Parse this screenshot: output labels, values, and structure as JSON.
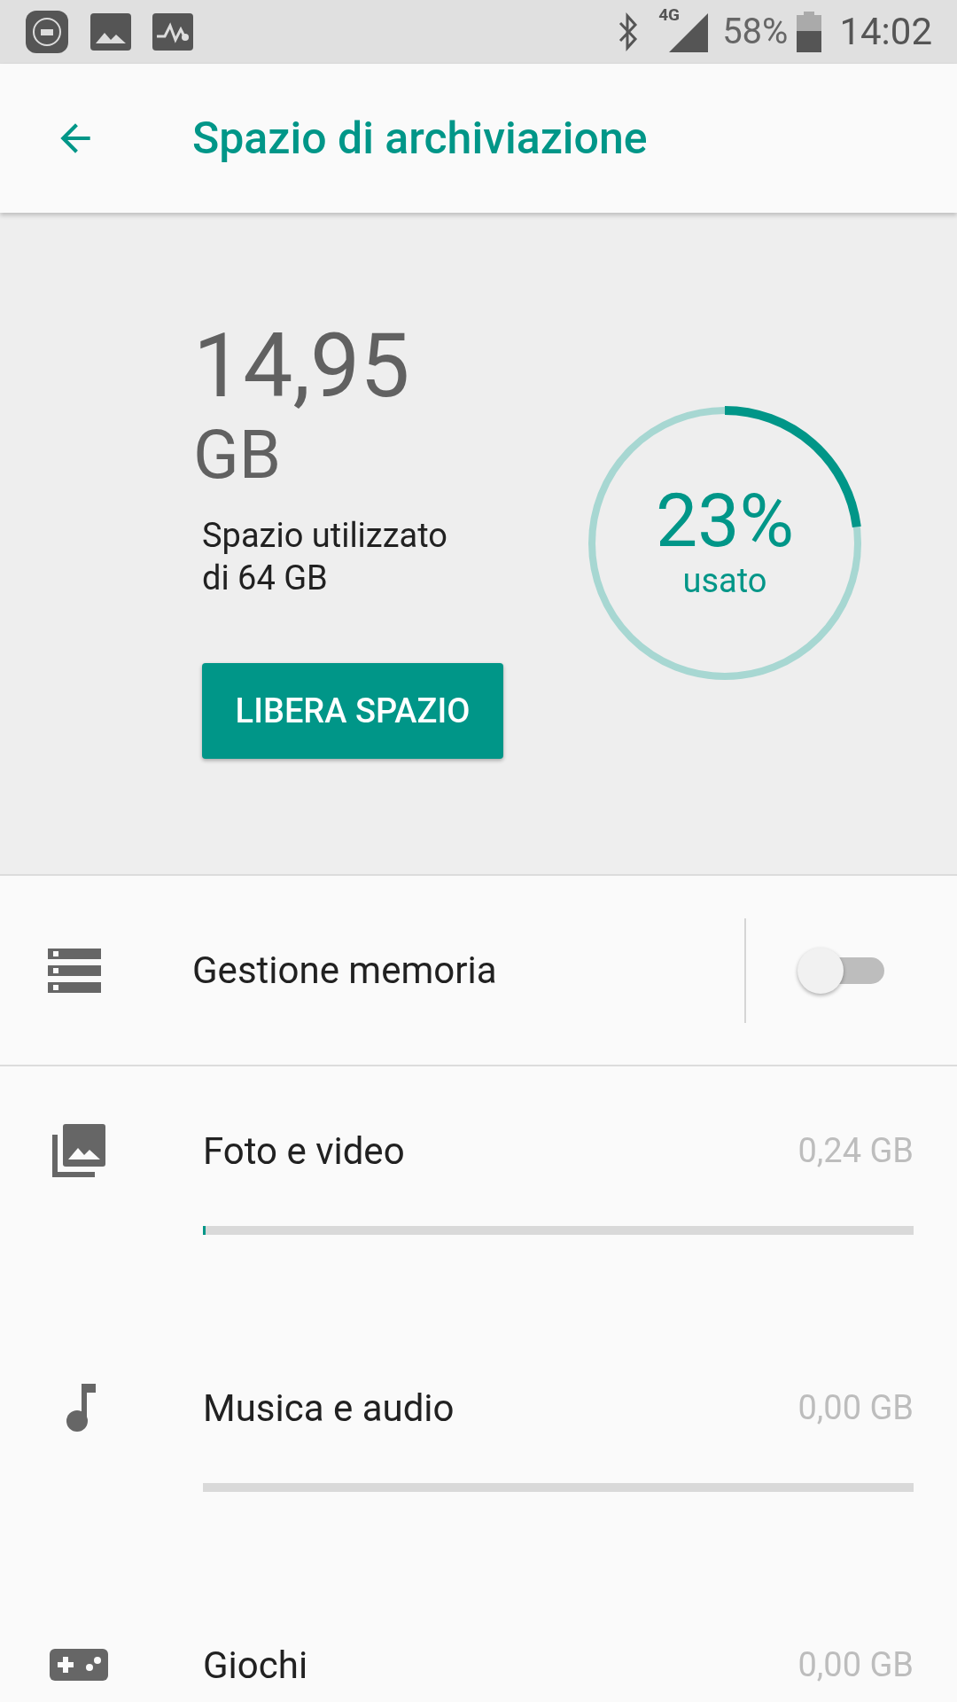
{
  "status_bar": {
    "battery": "58%",
    "time": "14:02",
    "network": "4G"
  },
  "app_bar": {
    "title": "Spazio di archiviazione"
  },
  "summary": {
    "used_amount": "14,95",
    "used_unit": "GB",
    "caption": "Spazio utilizzato\ndi 64 GB",
    "percent": "23%",
    "percent_label": "usato",
    "level": 0.23,
    "button": "LIBERA SPAZIO"
  },
  "storage_manager": {
    "label": "Gestione memoria",
    "on": false
  },
  "categories": [
    {
      "kind": "photos",
      "label": "Foto e video",
      "size": "0,24 GB",
      "level": 0.004
    },
    {
      "kind": "music",
      "label": "Musica e audio",
      "size": "0,00 GB",
      "level": 0
    },
    {
      "kind": "games",
      "label": "Giochi",
      "size": "0,00 GB"
    }
  ]
}
